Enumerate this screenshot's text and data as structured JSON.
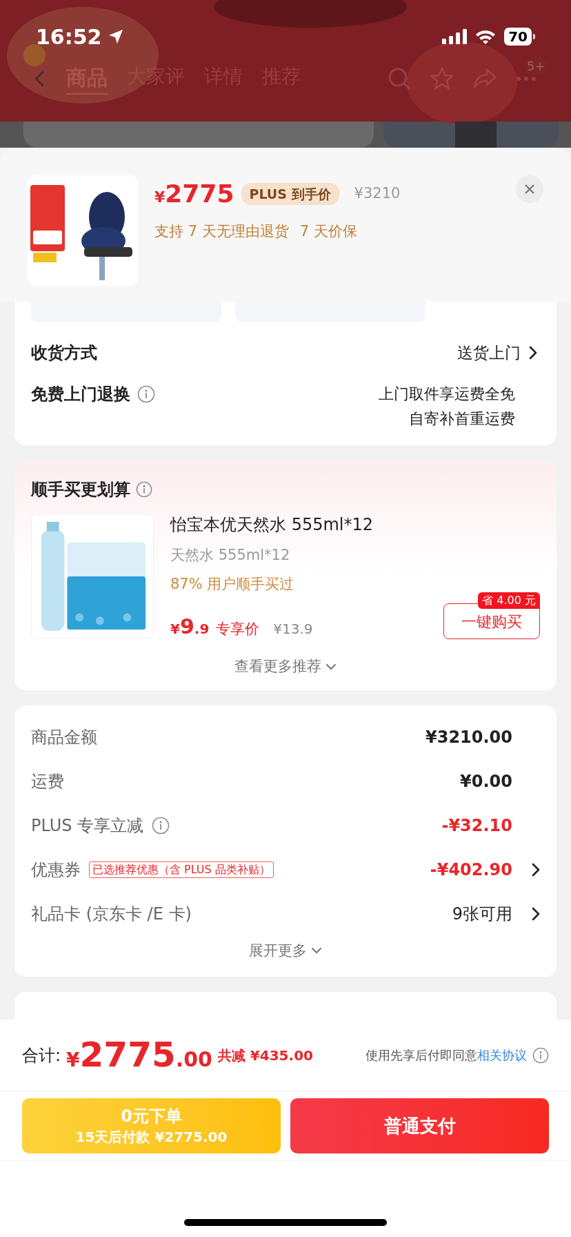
{
  "status_bar": {
    "time": "16:52",
    "battery": "70"
  },
  "background_nav": {
    "tabs": [
      {
        "label": "商品",
        "selected": true
      },
      {
        "label": "大家评",
        "selected": false
      },
      {
        "label": "详情",
        "selected": false
      },
      {
        "label": "推荐",
        "selected": false
      }
    ],
    "badge": "5+"
  },
  "product": {
    "price_symbol": "¥",
    "price": "2775",
    "tag": "PLUS 到手价",
    "original_price": "¥3210",
    "services": [
      "支持 7 天无理由退货",
      "7 天价保"
    ]
  },
  "delivery": {
    "label": "收货方式",
    "value": "送货上门"
  },
  "free_return": {
    "label": "免费上门退换",
    "lines": [
      "上门取件享运费全免",
      "自寄补首重运费"
    ]
  },
  "recommend": {
    "title": "顺手买更划算",
    "item": {
      "name": "怡宝本优天然水 555ml*12",
      "spec": "天然水 555ml*12",
      "note": "87% 用户顺手买过",
      "price_symbol": "¥",
      "price_int": "9",
      "price_dec": ".9",
      "price_label": "专享价",
      "original_price": "¥13.9",
      "save_badge": "省 4.00 元",
      "buy_button": "一键购买"
    },
    "more": "查看更多推荐"
  },
  "summary": {
    "rows": [
      {
        "label": "商品金额",
        "value": "¥3210.00",
        "kind": "plain",
        "info": false,
        "arrow": false
      },
      {
        "label": "运费",
        "value": "¥0.00",
        "kind": "plain",
        "info": false,
        "arrow": false
      },
      {
        "label": "PLUS 专享立减",
        "value": "-¥32.10",
        "kind": "discount",
        "info": true,
        "arrow": false
      },
      {
        "label": "优惠券",
        "tag": "已选推荐优惠（含 PLUS 品类补贴）",
        "value": "-¥402.90",
        "kind": "discount",
        "info": false,
        "arrow": true
      },
      {
        "label": "礼品卡 (京东卡 /E 卡)",
        "value": "9张可用",
        "kind": "count",
        "info": false,
        "arrow": true
      }
    ],
    "more": "展开更多"
  },
  "footer": {
    "total_label": "合计:",
    "currency": "¥",
    "total_int": "2775",
    "total_dec": ".00",
    "saved": "共减 ¥435.00",
    "agreement": "使用先享后付即同意",
    "agreement_link": "相关协议"
  },
  "buttons": [
    {
      "kind": "later",
      "title": "0元下单",
      "subtitle": "15天后付款 ¥2775.00"
    },
    {
      "kind": "pay",
      "title": "普通支付"
    }
  ]
}
